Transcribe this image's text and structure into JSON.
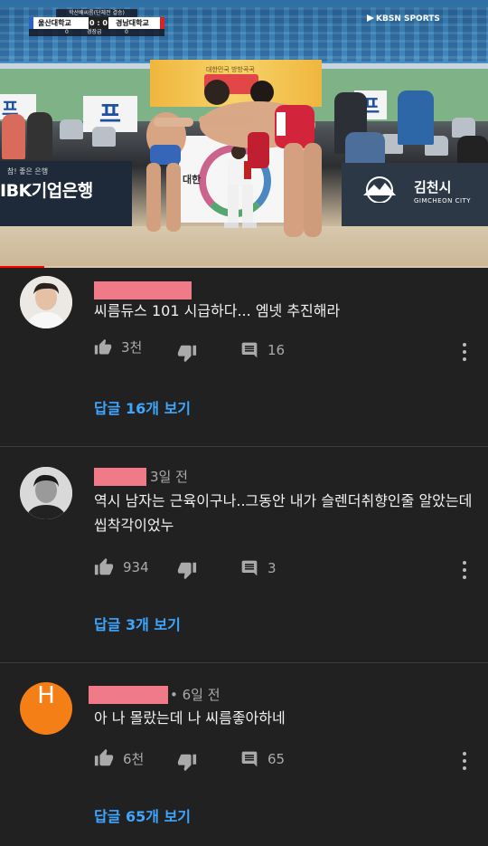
{
  "video": {
    "scoreboard": {
      "tournament": "학산배씨름(단체전 결승)",
      "team_left": "울산대학교",
      "score": "0 : 0",
      "team_right": "경남대학교",
      "sub_left": "0",
      "sub_mid": "경장급",
      "sub_right": "0"
    },
    "broadcaster": "KBSN SPORTS",
    "boards": {
      "ibk_small": "참! 좋은 은행",
      "ibk": "IBK기업은행",
      "gimcheon": "김천시",
      "gimcheon_en": "GIMCHEON CITY",
      "wall_left": "프",
      "wall_mid": "프",
      "wall_right": "프",
      "banner_small": "대한민국 방방곡곡",
      "ref_board": "대한"
    },
    "progress_fraction": 0.09
  },
  "comments": [
    {
      "text": "씨름듀스 101 시급하다... 엠넷 추진해라",
      "time": "",
      "likes": "3천",
      "reply_count": "16",
      "view_replies": "답글 16개 보기",
      "avatar": "person-photo"
    },
    {
      "text": "역시 남자는 근육이구나..그동안 내가 슬렌더취향인줄 알았는데 씹착각이었누",
      "time": "3일 전",
      "likes": "934",
      "reply_count": "3",
      "view_replies": "답글 3개 보기",
      "avatar": "person-photo-bw"
    },
    {
      "text": "아 나 몰랐는데 나 씨름좋아하네",
      "time": "• 6일 전",
      "likes": "6천",
      "reply_count": "65",
      "view_replies": "답글 65개 보기",
      "avatar_letter": "H",
      "avatar_color": "#f57f17"
    }
  ],
  "colors": {
    "background": "#212121",
    "link": "#3ea6ff",
    "redaction": "#f07a87"
  }
}
